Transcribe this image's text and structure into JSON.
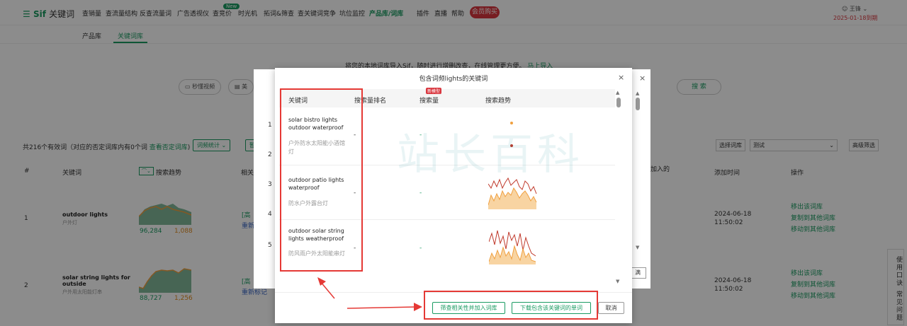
{
  "nav": {
    "logo_main": "Sif",
    "logo_sub": "关键词",
    "items": [
      "查销量",
      "查流量结构",
      "反查流量词",
      "广告透视仪",
      "查竞价",
      "时光机",
      "拓词&筛查",
      "查关键词竞争",
      "坑位监控",
      "产品库/词库",
      "插件",
      "直播",
      "帮助"
    ],
    "new_badge": "New",
    "vip_button": "会员购买",
    "user_name": "王锋",
    "user_expire": "2025-01-18到期"
  },
  "subtabs": [
    "产品库",
    "关键词库"
  ],
  "background": {
    "promo_text": "将您的本地词库导入Sif，随时进行增删改查，在线管理更方便。",
    "promo_link": "马上导入",
    "pill_video": "秒懂视频",
    "pill_market": "美",
    "search_button": "搜 索",
    "count_text": "共216个有效词（对应的否定词库内有0个词",
    "count_link": "查看否定词库",
    "count_close": ")",
    "btn_stats": "词频统计",
    "btn_more": "暂",
    "lib_label": "选择词库",
    "lib_value": "测试",
    "adv_filter": "高级筛选",
    "headers": {
      "num": "#",
      "kw": "关键词",
      "trend": "搜索趋势",
      "related": "相关",
      "added": "加入的",
      "time": "添加时间",
      "ops": "操作"
    },
    "rows": [
      {
        "num": "1",
        "kw": "outdoor lights",
        "cn": "户外灯",
        "vol": "96,284",
        "rank": "1,088",
        "tag": "[高",
        "refresh": "重新",
        "time1": "2024-06-18",
        "time2": "11:50:02"
      },
      {
        "num": "2",
        "kw": "solar string lights for outside",
        "cn": "户外用太阳能灯串",
        "vol": "88,727",
        "rank": "1,256",
        "tag": "[高",
        "refresh": "重新标记",
        "time1": "2024-06-18",
        "time2": "11:50:02"
      }
    ],
    "ops": [
      "移出该词库",
      "复制到其他词库",
      "移动到其他词库"
    ],
    "side_tab": "使用口诀 常见问题",
    "behind_nums": [
      "1",
      "2",
      "3",
      "4",
      "5"
    ],
    "behind_btn": "满"
  },
  "modal": {
    "title": "包含词频lights的关键词",
    "col_kw": "关键词",
    "col_rank": "搜索量排名",
    "col_vol": "搜索量",
    "col_trend": "搜索趋势",
    "hot_badge": "新模型",
    "rows": [
      {
        "en": "solar bistro lights outdoor waterproof",
        "cn": "户外防水太阳能小酒馆灯",
        "rank": "-",
        "vol": "-"
      },
      {
        "en": "outdoor patio lights waterproof",
        "cn": "防水户外露台灯",
        "rank": "-",
        "vol": "-"
      },
      {
        "en": "outdoor solar string lights weatherproof",
        "cn": "防风雨户外太阳能串灯",
        "rank": "-",
        "vol": "-"
      }
    ],
    "btn_filter": "筛查相关性并加入词库",
    "btn_download": "下载包含该关键词的单词",
    "btn_cancel": "取消",
    "watermark": "站长百科"
  },
  "colors": {
    "brand": "#1a9b62",
    "annotation": "#e53935",
    "trend_red": "#c0392b",
    "trend_orange": "#f0a040"
  }
}
